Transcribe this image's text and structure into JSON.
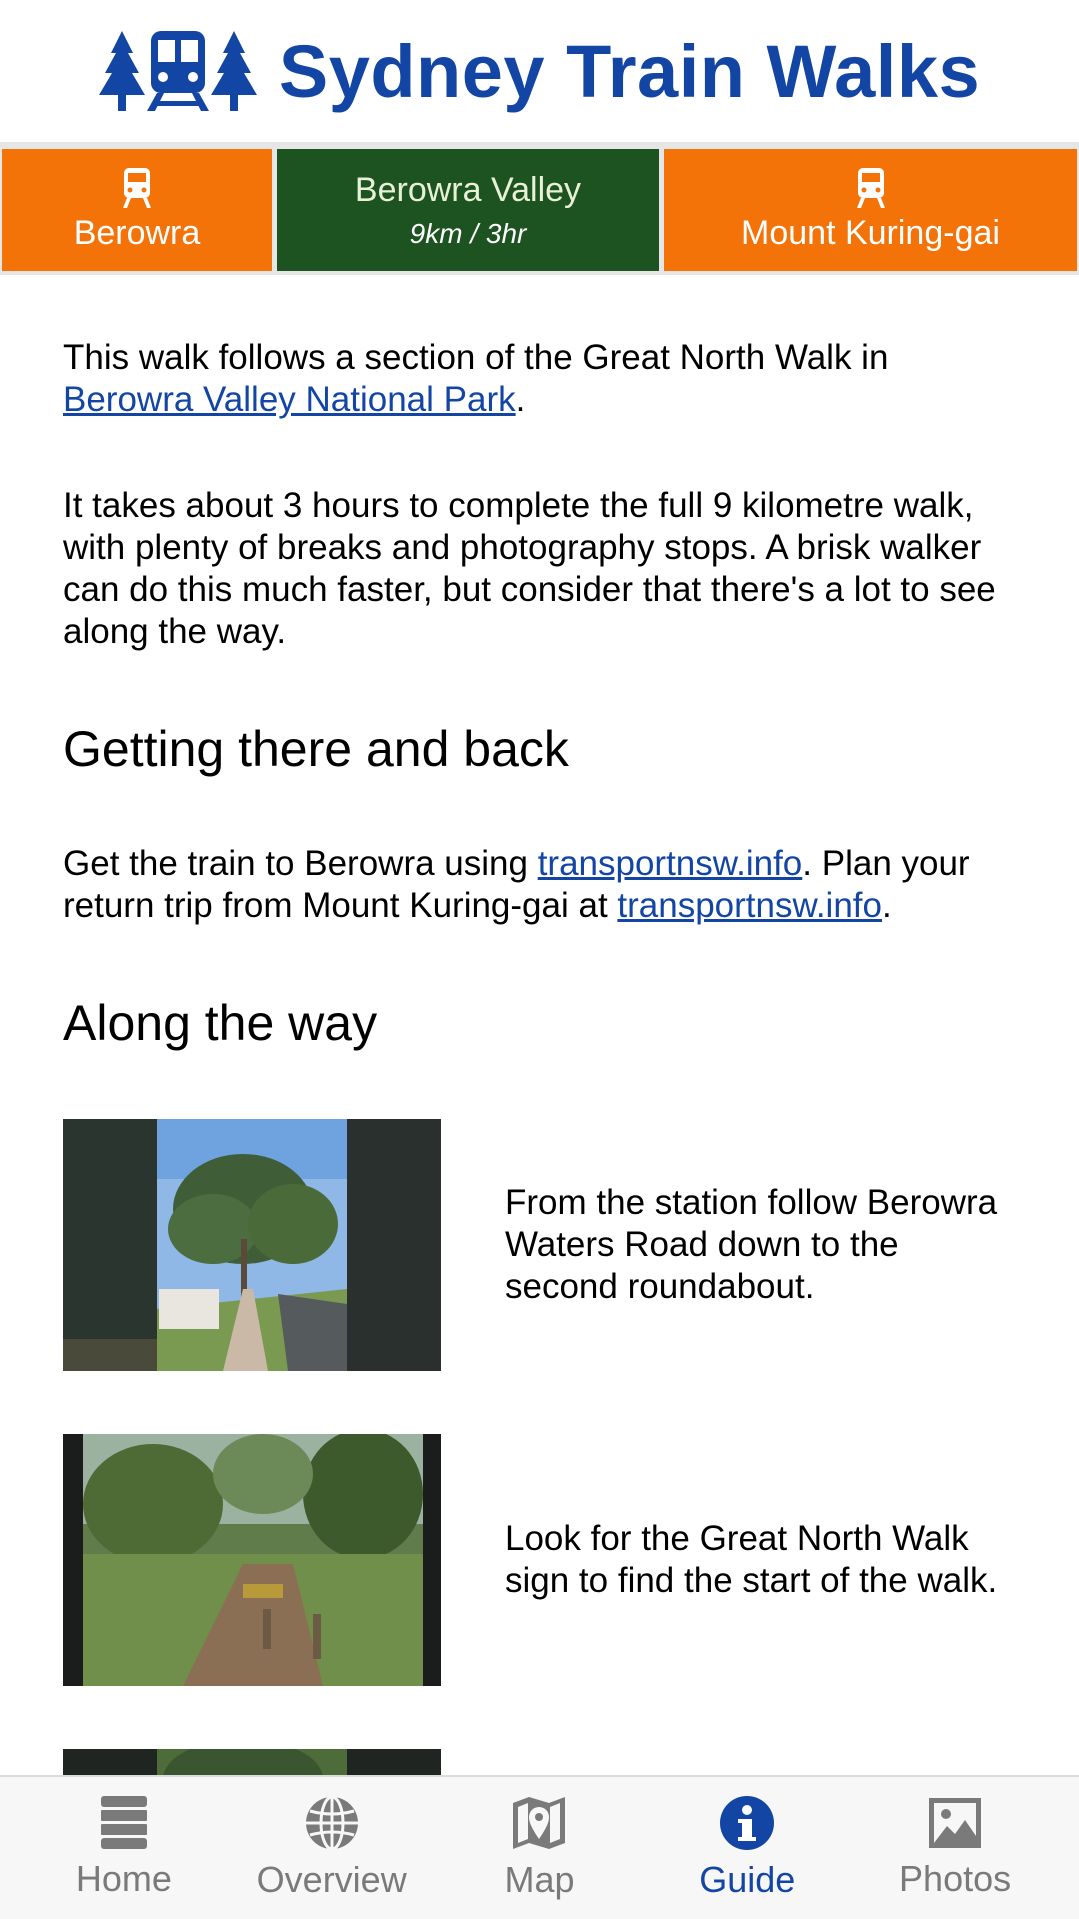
{
  "header": {
    "title": "Sydney Train Walks"
  },
  "route": {
    "start_station": "Berowra",
    "walk_name": "Berowra Valley",
    "walk_meta": "9km / 3hr",
    "end_station": "Mount Kuring-gai"
  },
  "intro": {
    "text_before": "This walk follows a section of the Great North Walk in ",
    "park_link": "Berowra Valley National Park",
    "text_after": ".",
    "duration_text": "It takes about 3 hours to complete the full 9 kilometre walk, with plenty of breaks and photography stops. A brisk walker can do this much faster, but consider that there's a lot to see along the way."
  },
  "getting_there": {
    "heading": "Getting there and back",
    "part1": "Get the train to Berowra using ",
    "link1": "transportnsw.info",
    "part2": ". Plan your return trip from Mount Kuring-gai at ",
    "link2": "transportnsw.info",
    "part3": "."
  },
  "along_the_way": {
    "heading": "Along the way",
    "items": [
      {
        "text": "From the station follow Berowra Waters Road down to the second roundabout."
      },
      {
        "text": "Look for the Great North Walk sign to find the start of the walk."
      }
    ]
  },
  "tabs": [
    {
      "label": "Home",
      "icon": "home-list-icon"
    },
    {
      "label": "Overview",
      "icon": "globe-icon"
    },
    {
      "label": "Map",
      "icon": "map-pin-icon"
    },
    {
      "label": "Guide",
      "icon": "info-icon",
      "active": true
    },
    {
      "label": "Photos",
      "icon": "photo-icon"
    }
  ],
  "colors": {
    "brand_blue": "#1346a4",
    "station_orange": "#f47308",
    "walk_green": "#1c5320"
  }
}
